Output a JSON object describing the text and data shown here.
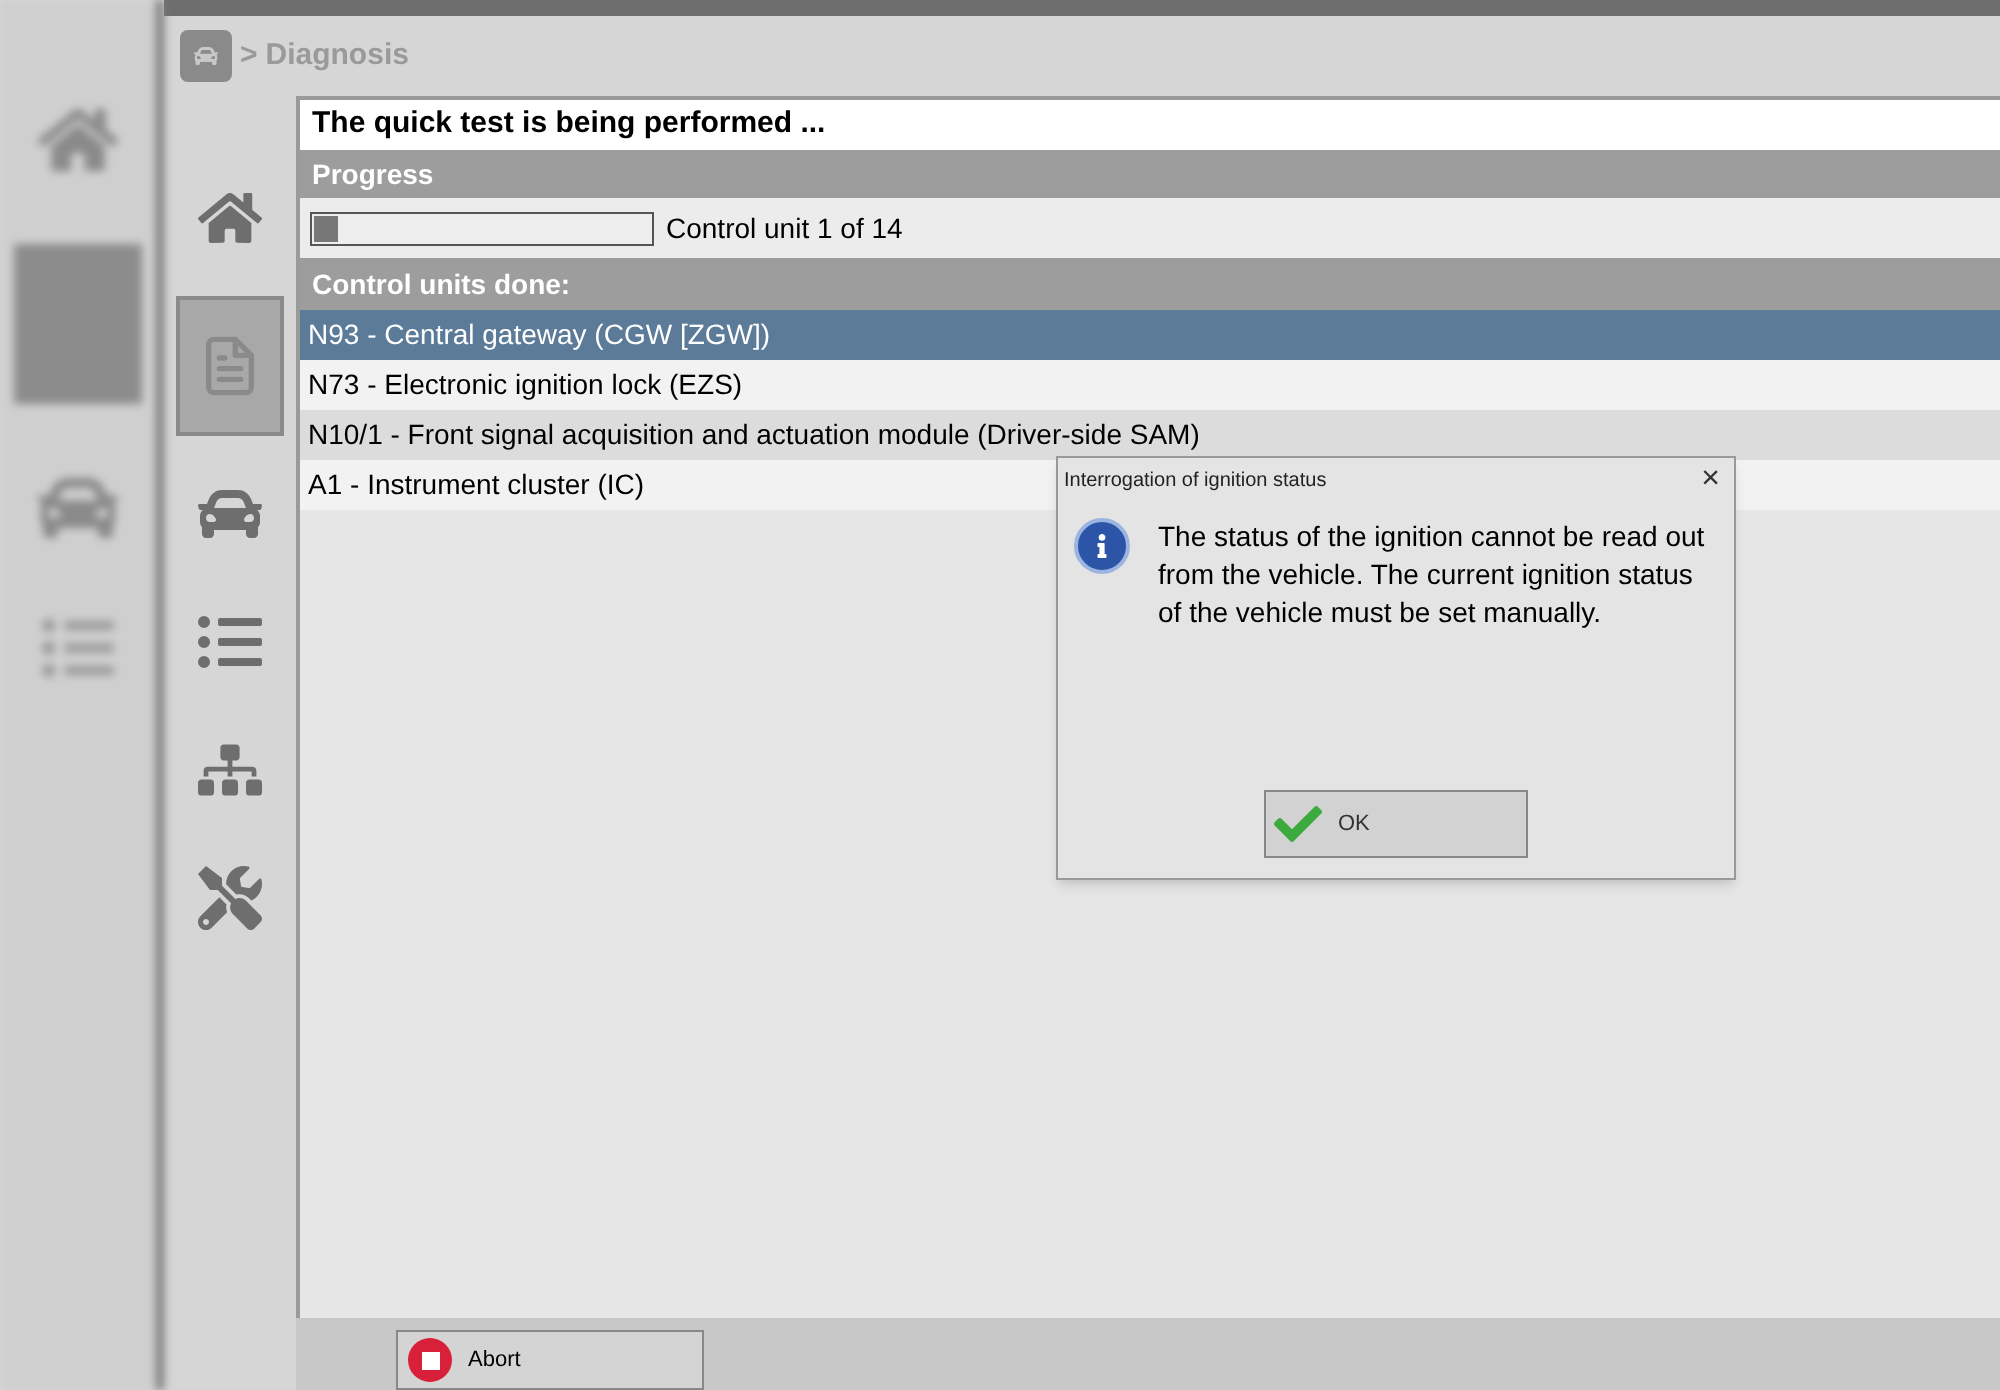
{
  "breadcrumb": {
    "separator": ">",
    "title": "Diagnosis"
  },
  "nav": [
    {
      "kind": "home",
      "selected": false
    },
    {
      "kind": "document",
      "selected": true
    },
    {
      "kind": "car",
      "selected": false
    },
    {
      "kind": "list",
      "selected": false
    },
    {
      "kind": "tree",
      "selected": false
    },
    {
      "kind": "tools",
      "selected": false
    }
  ],
  "panel": {
    "title": "The quick test is being performed ...",
    "progress_heading": "Progress",
    "progress": {
      "level": 0.07,
      "reading": "Control unit 1 of 14"
    },
    "done_heading": "Control units done:",
    "units": [
      {
        "label": "N93 - Central gateway (CGW [ZGW])",
        "selected": true
      },
      {
        "label": "N73 - Electronic ignition lock (EZS)",
        "selected": false
      },
      {
        "label": "N10/1 - Front signal acquisition and actuation module (Driver-side SAM)",
        "selected": false
      },
      {
        "label": "A1 - Instrument cluster (IC)",
        "selected": false
      }
    ]
  },
  "dialog": {
    "title": "Interrogation of ignition status",
    "close": "×",
    "message": "The status of the ignition cannot be read out from the vehicle. The current ignition status of the vehicle must be set manually.",
    "button": "OK"
  },
  "footer": {
    "abort": "Abort"
  }
}
